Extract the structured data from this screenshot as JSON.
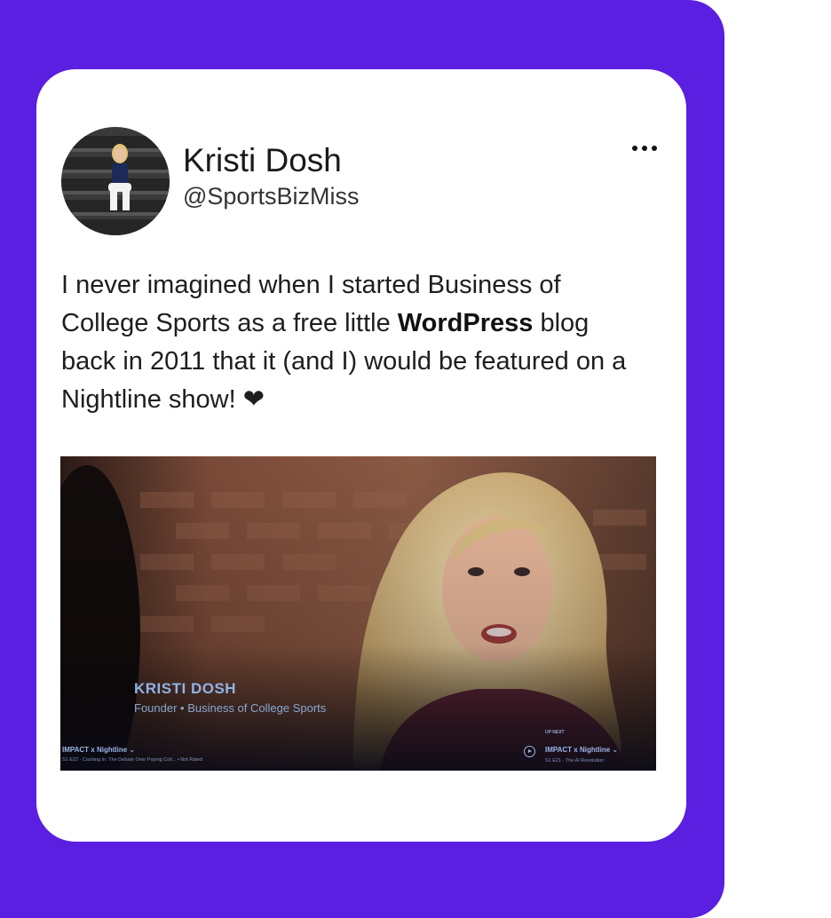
{
  "colors": {
    "frame": "#5a1fe0",
    "card": "#ffffff",
    "text": "#1e1e1e"
  },
  "user": {
    "name": "Kristi Dosh",
    "handle": "@SportsBizMiss"
  },
  "more_icon": "ellipsis-icon",
  "tweet": {
    "before_bold": "I never imagined when I started Business of College Sports as a free little ",
    "bold": "WordPress",
    "after_bold": " blog back in 2011 that it (and I) would be featured on a Nightline show! ❤"
  },
  "video": {
    "lower_third_name": "KRISTI DOSH",
    "lower_third_title": "Founder • Business of College Sports",
    "current_show": "IMPACT x Nightline  ⌄",
    "current_episode": "S1 E22 - Cashing In: The Debate Over Paying Coll... • Not Rated",
    "up_next_label": "UP NEXT",
    "next_show": "IMPACT x Nightline  ⌄",
    "next_episode": "S1 E21 - The AI Revolution"
  }
}
